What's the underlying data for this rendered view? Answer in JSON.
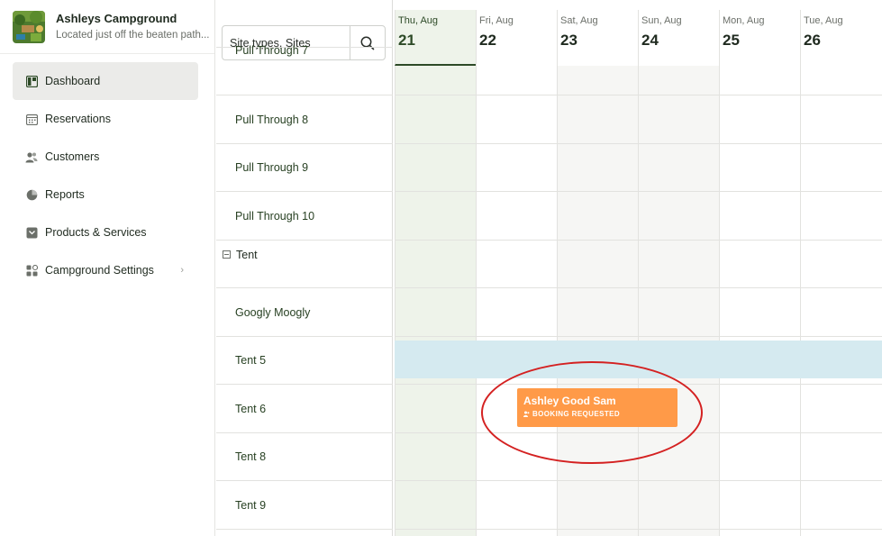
{
  "brand": {
    "name": "Ashleys Campground",
    "tagline": "Located just off the beaten path...",
    "logo_icon": "campground-photo-logo"
  },
  "nav": [
    {
      "label": "Dashboard",
      "icon": "dashboard-icon",
      "active": true
    },
    {
      "label": "Reservations",
      "icon": "calendar-icon",
      "active": false
    },
    {
      "label": "Customers",
      "icon": "users-icon",
      "active": false
    },
    {
      "label": "Reports",
      "icon": "pie-chart-icon",
      "active": false
    },
    {
      "label": "Products & Services",
      "icon": "box-icon",
      "active": false
    },
    {
      "label": "Campground Settings",
      "icon": "grid-icon",
      "active": false,
      "has_submenu": true
    }
  ],
  "search": {
    "placeholder": "Site types, Sites"
  },
  "sites": [
    {
      "label": "Pull Through 7"
    },
    {
      "label": "Pull Through 8"
    },
    {
      "label": "Pull Through 9"
    },
    {
      "label": "Pull Through 10"
    },
    {
      "label": "Tent",
      "group": true
    },
    {
      "label": "Googly Moogly"
    },
    {
      "label": "Tent 5"
    },
    {
      "label": "Tent 6"
    },
    {
      "label": "Tent 8"
    },
    {
      "label": "Tent 9"
    }
  ],
  "days": [
    {
      "label": "Thu, Aug",
      "num": "21",
      "today": true
    },
    {
      "label": "Fri, Aug",
      "num": "22"
    },
    {
      "label": "Sat, Aug",
      "num": "23",
      "weekend": true
    },
    {
      "label": "Sun, Aug",
      "num": "24",
      "weekend": true
    },
    {
      "label": "Mon, Aug",
      "num": "25"
    },
    {
      "label": "Tue, Aug",
      "num": "26"
    }
  ],
  "booking": {
    "guest": "Ashley Good Sam",
    "status": "BOOKING REQUESTED",
    "color": "#ff9a48"
  },
  "colors": {
    "accent": "#2d4a27",
    "blocked": "#d5eaf0",
    "highlight_circle": "#d42121"
  }
}
